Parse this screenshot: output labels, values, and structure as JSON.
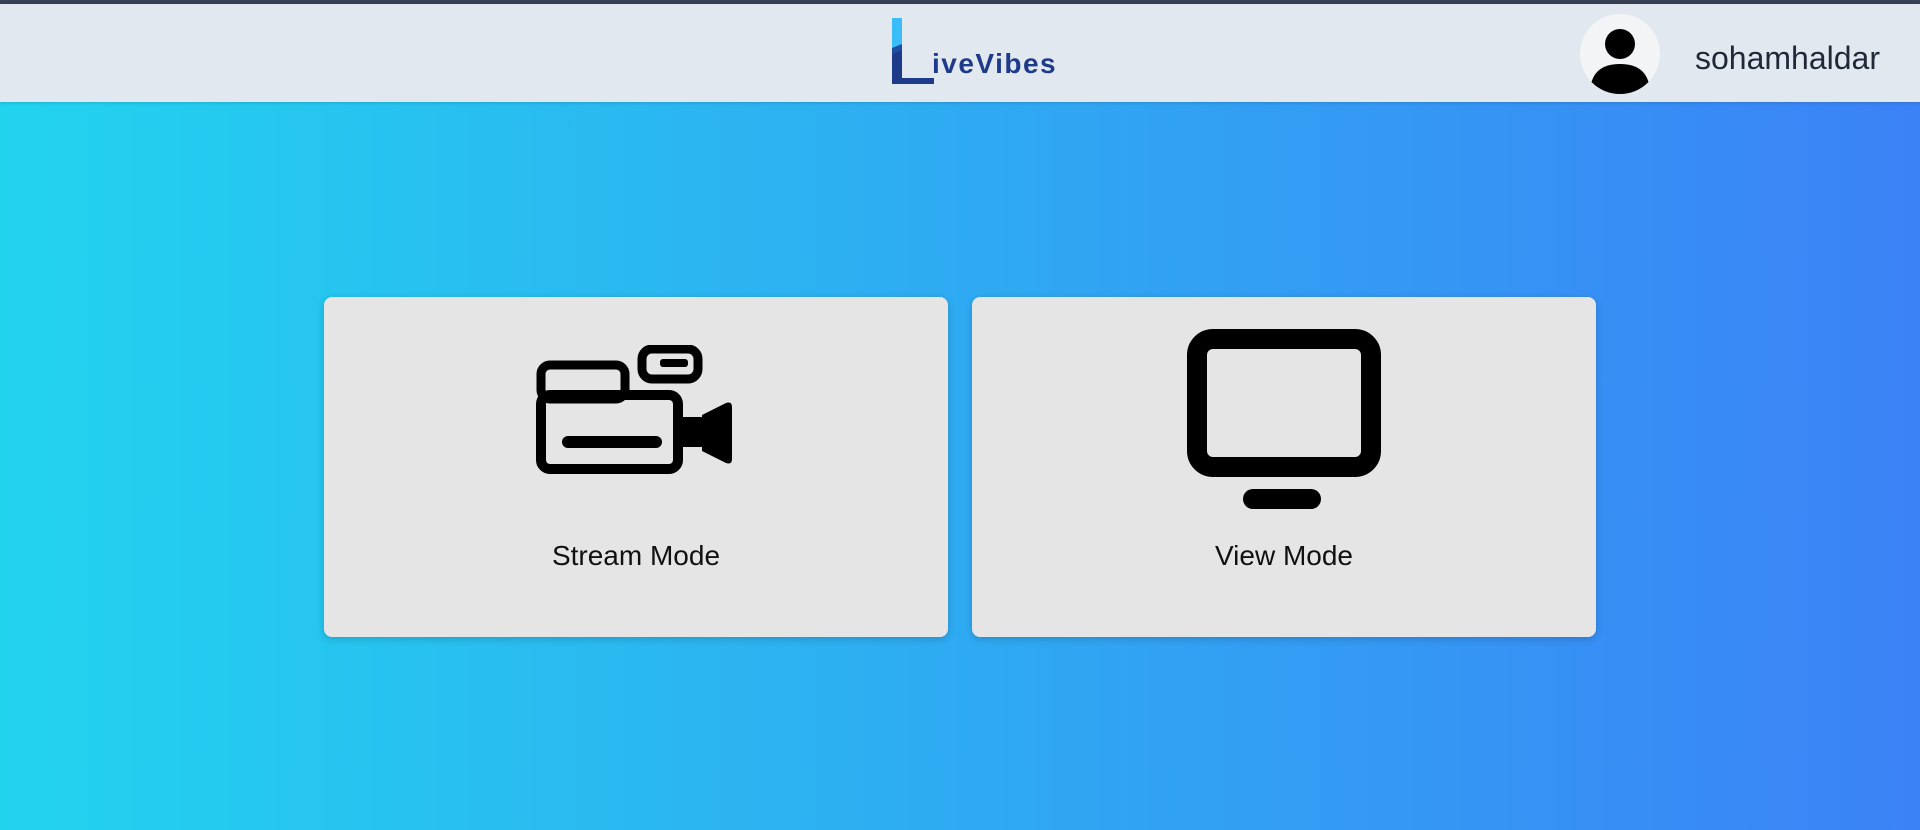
{
  "app": {
    "name": "LiveVibes",
    "logo_text": "iveVibes"
  },
  "header": {
    "username": "sohamhaldar"
  },
  "modes": [
    {
      "label": "Stream Mode",
      "icon": "video-camera-icon"
    },
    {
      "label": "View Mode",
      "icon": "monitor-icon"
    }
  ],
  "colors": {
    "gradient_start": "#22d3ee",
    "gradient_end": "#3b82f6",
    "navbar_bg": "#e2e8f0",
    "card_bg": "#e5e5e5",
    "logo_blue": "#1e3a8a"
  }
}
